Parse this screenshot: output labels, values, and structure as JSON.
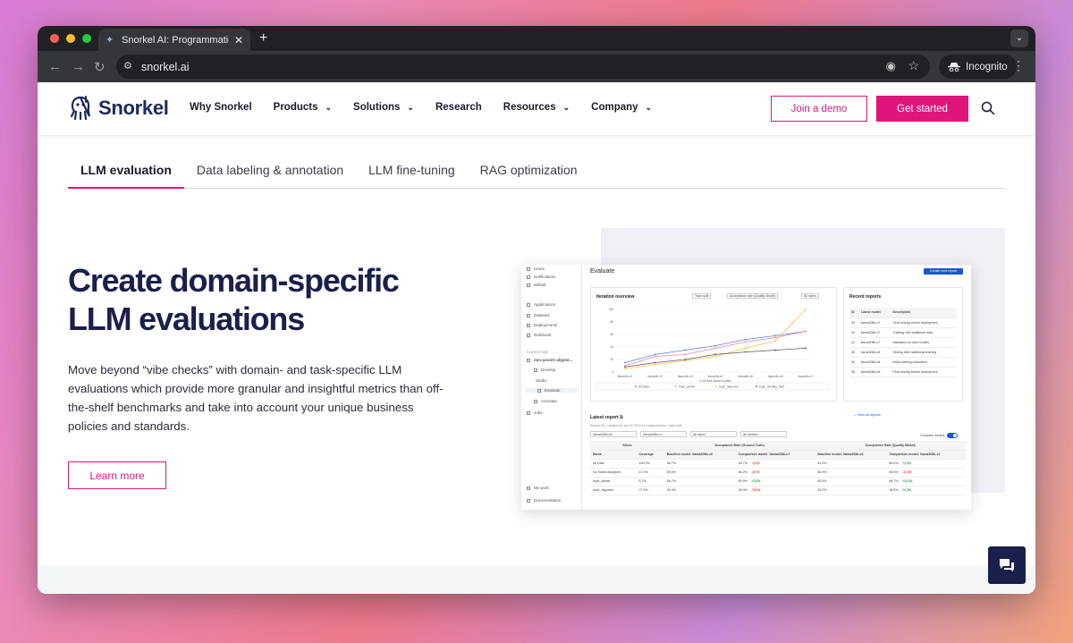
{
  "browser": {
    "tab_title": "Snorkel AI: Programmatic AI D",
    "url": "snorkel.ai",
    "incognito_label": "Incognito"
  },
  "site": {
    "logo_text": "Snorkel",
    "nav": [
      {
        "label": "Why Snorkel",
        "has_menu": false
      },
      {
        "label": "Products",
        "has_menu": true
      },
      {
        "label": "Solutions",
        "has_menu": true
      },
      {
        "label": "Research",
        "has_menu": false
      },
      {
        "label": "Resources",
        "has_menu": true
      },
      {
        "label": "Company",
        "has_menu": true
      }
    ],
    "demo_button": "Join a demo",
    "start_button": "Get started",
    "accent_color": "#e0157a",
    "navy_color": "#1b1f4b"
  },
  "section_tabs": [
    {
      "label": "LLM evaluation",
      "active": true
    },
    {
      "label": "Data labeling & annotation",
      "active": false
    },
    {
      "label": "LLM fine-tuning",
      "active": false
    },
    {
      "label": "RAG optimization",
      "active": false
    }
  ],
  "hero": {
    "title_line1": "Create domain-specific",
    "title_line2": "LLM evaluations",
    "body": "Move beyond “vibe checks” with domain- and task-specific LLM evaluations which provide more granular and insightful metrics than off-the-shelf benchmarks and take into account your unique business policies and standards.",
    "cta": "Learn more"
  },
  "app_preview": {
    "sidebar": {
      "items_top": [
        "Home",
        "Notifications",
        "default"
      ],
      "items_mid": [
        "Applications",
        "Datasets",
        "Deployments",
        "Notebook"
      ],
      "current_app_label": "Current App",
      "current_app": "mm-june21-aligme...",
      "develop": "Develop",
      "studio": "Studio",
      "evaluate": "Evaluate",
      "annotate": "Annotate",
      "jobs": "Jobs",
      "my_work": "My work",
      "documentation": "Documentation"
    },
    "header": "Evaluate",
    "new_report_button": "Create new report",
    "iteration": {
      "title": "Iteration overview",
      "filters": [
        "Train split",
        "Acceptance rate (Quality Model)",
        "All slices"
      ],
      "y_ticks": [
        "100",
        "80",
        "60",
        "40",
        "20",
        "0"
      ],
      "x_ticks": [
        "llama3b-v1",
        "llama3b-v2",
        "llama3b-v3",
        "llama3b-v4",
        "llama3b-v5",
        "llama3b-v6",
        "llama3b-v7"
      ],
      "x_caption": "LLM (fine-tuned model)",
      "legend": [
        "All Data",
        "topic_admin",
        "topic_disputes",
        "topic_identity_theft"
      ],
      "series_colors": [
        "#5b7fe0",
        "#e87fa8",
        "#f2c23a",
        "#555555"
      ],
      "series": [
        {
          "name": "All Data",
          "values": [
            15,
            28,
            35,
            42,
            52,
            58,
            65
          ]
        },
        {
          "name": "topic_admin",
          "values": [
            10,
            25,
            28,
            38,
            48,
            55,
            65
          ]
        },
        {
          "name": "topic_disputes",
          "values": [
            5,
            12,
            18,
            25,
            38,
            50,
            100
          ]
        },
        {
          "name": "topic_identity_theft",
          "values": [
            8,
            15,
            20,
            28,
            32,
            35,
            38
          ]
        }
      ]
    },
    "recent": {
      "title": "Recent reports",
      "headers": [
        "ID",
        "Latest model",
        "Description"
      ],
      "rows": [
        [
          "43",
          "llama308b-v7",
          "Final testing before deployment"
        ],
        [
          "42",
          "llama308b-v7",
          "Training with additional data"
        ],
        [
          "41",
          "llama308b-v7",
          "Validation on new models"
        ],
        [
          "40",
          "llama308b-v6",
          "Testing after additional training"
        ],
        [
          "39",
          "llama308b-v6",
          "Initial training evaluation"
        ],
        [
          "38",
          "llama308b-v5",
          "Final testing before deployment"
        ]
      ],
      "view_all": "→ View all reports"
    },
    "latest": {
      "title": "Latest report",
      "subtitle": "Report #2 • created on Jun 22 2024 by marty.moxess • train split",
      "filters": [
        "llama308b-v6",
        "llama308b-v7",
        "All slices",
        "All metrics"
      ],
      "compare_label": "Compare models",
      "group_headers": [
        "Slices",
        "Acceptance Rate (Ground Truth)",
        "Acceptance Rate (Quality Model)"
      ],
      "headers": [
        "Name",
        "Coverage",
        "Baseline model: llama308b-v6",
        "Comparison model: llama308b-v7",
        "Baseline model: llama308b-v6",
        "Comparison model: llama308b-v7"
      ],
      "rows": [
        {
          "name": "All Data",
          "coverage": "100.0%",
          "b1": "56.7%",
          "c1": "54.7%",
          "d1": "-2.0%",
          "d1_up": false,
          "b2": "61.0%",
          "c2": "68.0%",
          "d2": "+1.0%",
          "d2_up": true
        },
        {
          "name": "No Slices Assigned",
          "coverage": "47.0%",
          "b1": "69.0%",
          "c1": "60.2%",
          "d1": "-8.7%",
          "d1_up": false,
          "b2": "80.9%",
          "c2": "69.5%",
          "d2": "-11.3%",
          "d2_up": false
        },
        {
          "name": "topic_admin",
          "coverage": "8.7%",
          "b1": "66.7%",
          "c1": "69.9%",
          "d1": "+3.2%",
          "d1_up": true,
          "b2": "55.5%",
          "c2": "66.7%",
          "d2": "+11.2%",
          "d2_up": true
        },
        {
          "name": "topic_disputes",
          "coverage": "27.0%",
          "b1": "30.4%",
          "c1": "35.4%",
          "d1": "+5.0%",
          "d1_up": false,
          "b2": "34.2%",
          "c2": "38.5%",
          "d2": "+4.3%",
          "d2_up": true
        }
      ]
    }
  }
}
